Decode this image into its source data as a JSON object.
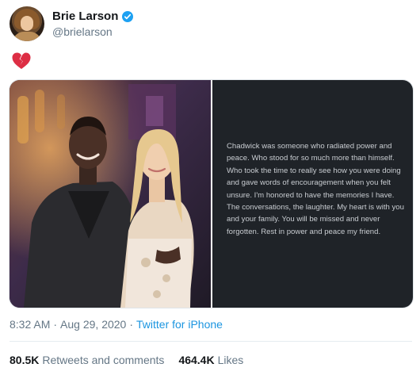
{
  "author": {
    "display_name": "Brie Larson",
    "handle": "@brielarson",
    "verified": true
  },
  "tweet": {
    "emoji": "broken-heart",
    "statement_text": "Chadwick was someone who radiated power and peace. Who stood for so much more than himself. Who took the time to really see how you were doing and gave words of encouragement when you felt unsure. I'm honored to have the memories I have. The conversations, the laughter. My heart is with you and your family. You will be missed and never forgotten. Rest in power and peace my friend."
  },
  "meta": {
    "time": "8:32 AM",
    "dot1": "·",
    "date": "Aug 29, 2020",
    "dot2": "·",
    "source": "Twitter for iPhone"
  },
  "stats": {
    "retweets_count": "80.5K",
    "retweets_label": "Retweets and comments",
    "likes_count": "464.4K",
    "likes_label": "Likes"
  },
  "colors": {
    "link": "#1b95e0",
    "secondary_text": "#657786",
    "verified_badge": "#1da1f2",
    "broken_heart": "#dd2e44"
  }
}
